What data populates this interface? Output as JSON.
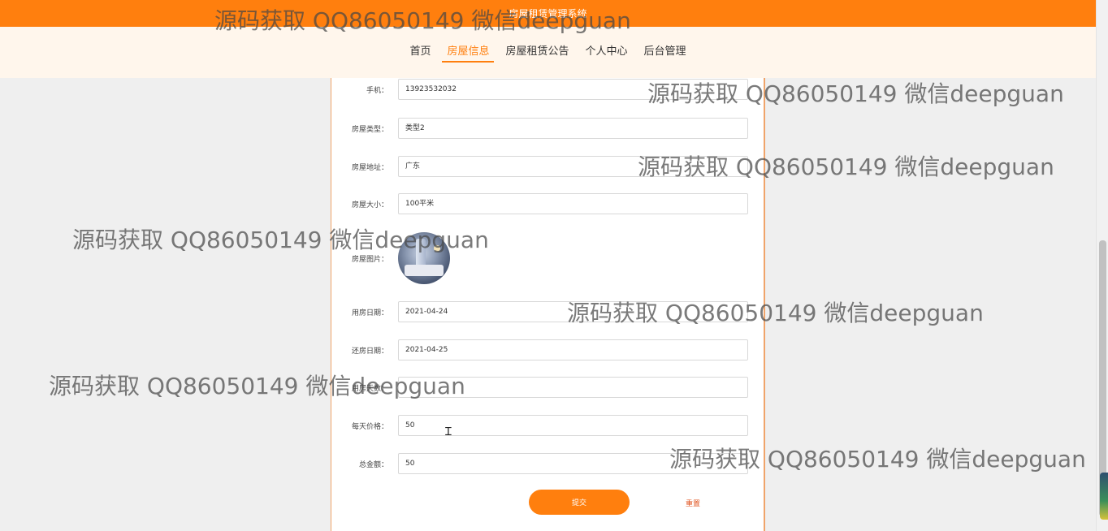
{
  "header": {
    "site_title": "房屋租赁管理系统"
  },
  "nav": {
    "items": [
      {
        "label": "首页"
      },
      {
        "label": "房屋信息"
      },
      {
        "label": "房屋租赁公告"
      },
      {
        "label": "个人中心"
      },
      {
        "label": "后台管理"
      }
    ],
    "active_index": 1
  },
  "form": {
    "fields": [
      {
        "label": "手机：",
        "value": "13923532032"
      },
      {
        "label": "房屋类型：",
        "value": "类型2"
      },
      {
        "label": "房屋地址：",
        "value": "广东"
      },
      {
        "label": "房屋大小：",
        "value": "100平米"
      },
      {
        "label": "房屋图片：",
        "value": ""
      },
      {
        "label": "用房日期：",
        "value": "2021-04-24"
      },
      {
        "label": "还房日期：",
        "value": "2021-04-25"
      },
      {
        "label": "用房天数：",
        "value": ""
      },
      {
        "label": "每天价格：",
        "value": "50"
      },
      {
        "label": "总金额：",
        "value": "50"
      }
    ],
    "submit_label": "提交",
    "reset_label": "重置"
  },
  "watermark": {
    "text": "源码获取 QQ86050149 微信deepguan"
  },
  "colors": {
    "accent": "#ff7f0e",
    "nav_bg": "#fff6ec",
    "page_bg": "#efefef",
    "reset_text": "#e0531f"
  },
  "icons": {
    "cursor": "text-cursor-icon"
  }
}
